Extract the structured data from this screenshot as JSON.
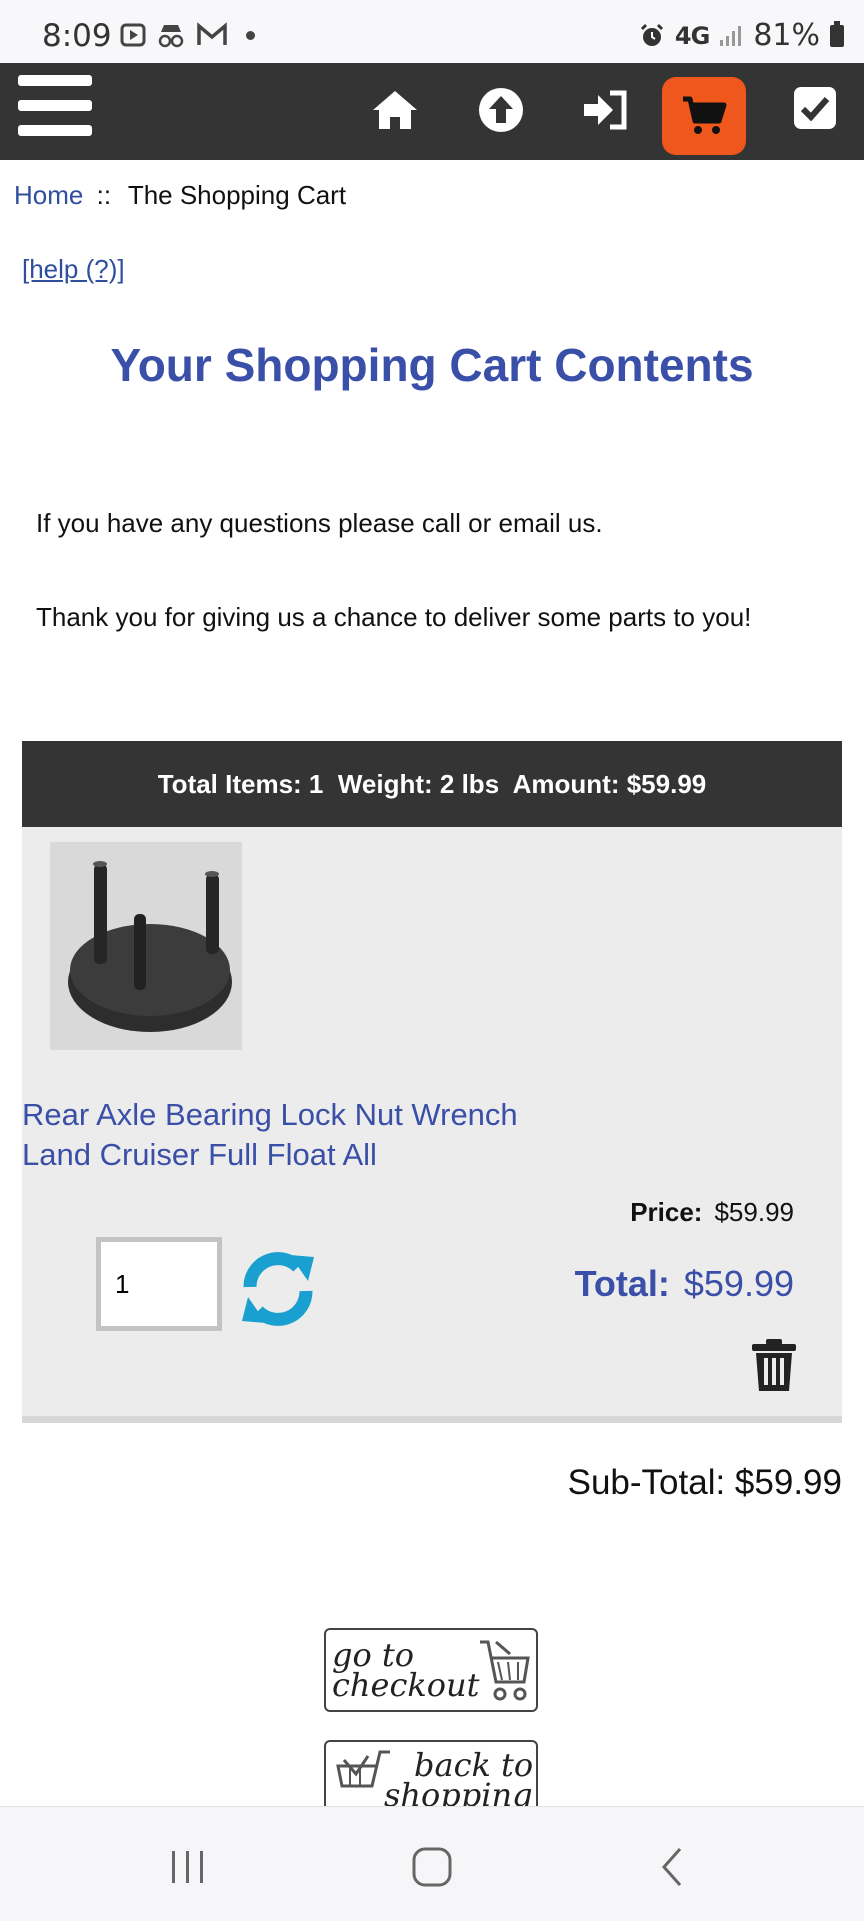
{
  "status_bar": {
    "time": "8:09",
    "network": "4G",
    "battery": "81%"
  },
  "nav": {
    "icons": [
      "menu-icon",
      "home-icon",
      "arrow-up-icon",
      "sign-in-icon",
      "cart-icon",
      "checkmark-icon"
    ],
    "cart_accent": "#f0571c",
    "bar_color": "#343434"
  },
  "breadcrumb": {
    "home": "Home",
    "separator": "::",
    "current": "The Shopping Cart"
  },
  "help_link": "[help (?)]",
  "page_title": "Your Shopping Cart Contents",
  "messages": {
    "questions": "If you have any questions please call or email us.",
    "thanks": "Thank you for giving us a chance to deliver some parts to you!"
  },
  "cart": {
    "summary": "Total Items: 1  Weight: 2 lbs  Amount: $59.99",
    "item": {
      "name_line1": "Rear Axle Bearing Lock Nut Wrench",
      "name_line2": "Land Cruiser Full Float All",
      "price_label": "Price:",
      "price": "$59.99",
      "quantity": "1",
      "total_label": "Total:",
      "total": "$59.99"
    },
    "subtotal": "Sub-Total: $59.99"
  },
  "buttons": {
    "checkout_line1": "go to",
    "checkout_line2": "checkout",
    "back_line1": "back to",
    "back_line2": "shopping"
  },
  "colors": {
    "link_blue": "#3a4fa8",
    "refresh_teal": "#1aa0d0"
  }
}
